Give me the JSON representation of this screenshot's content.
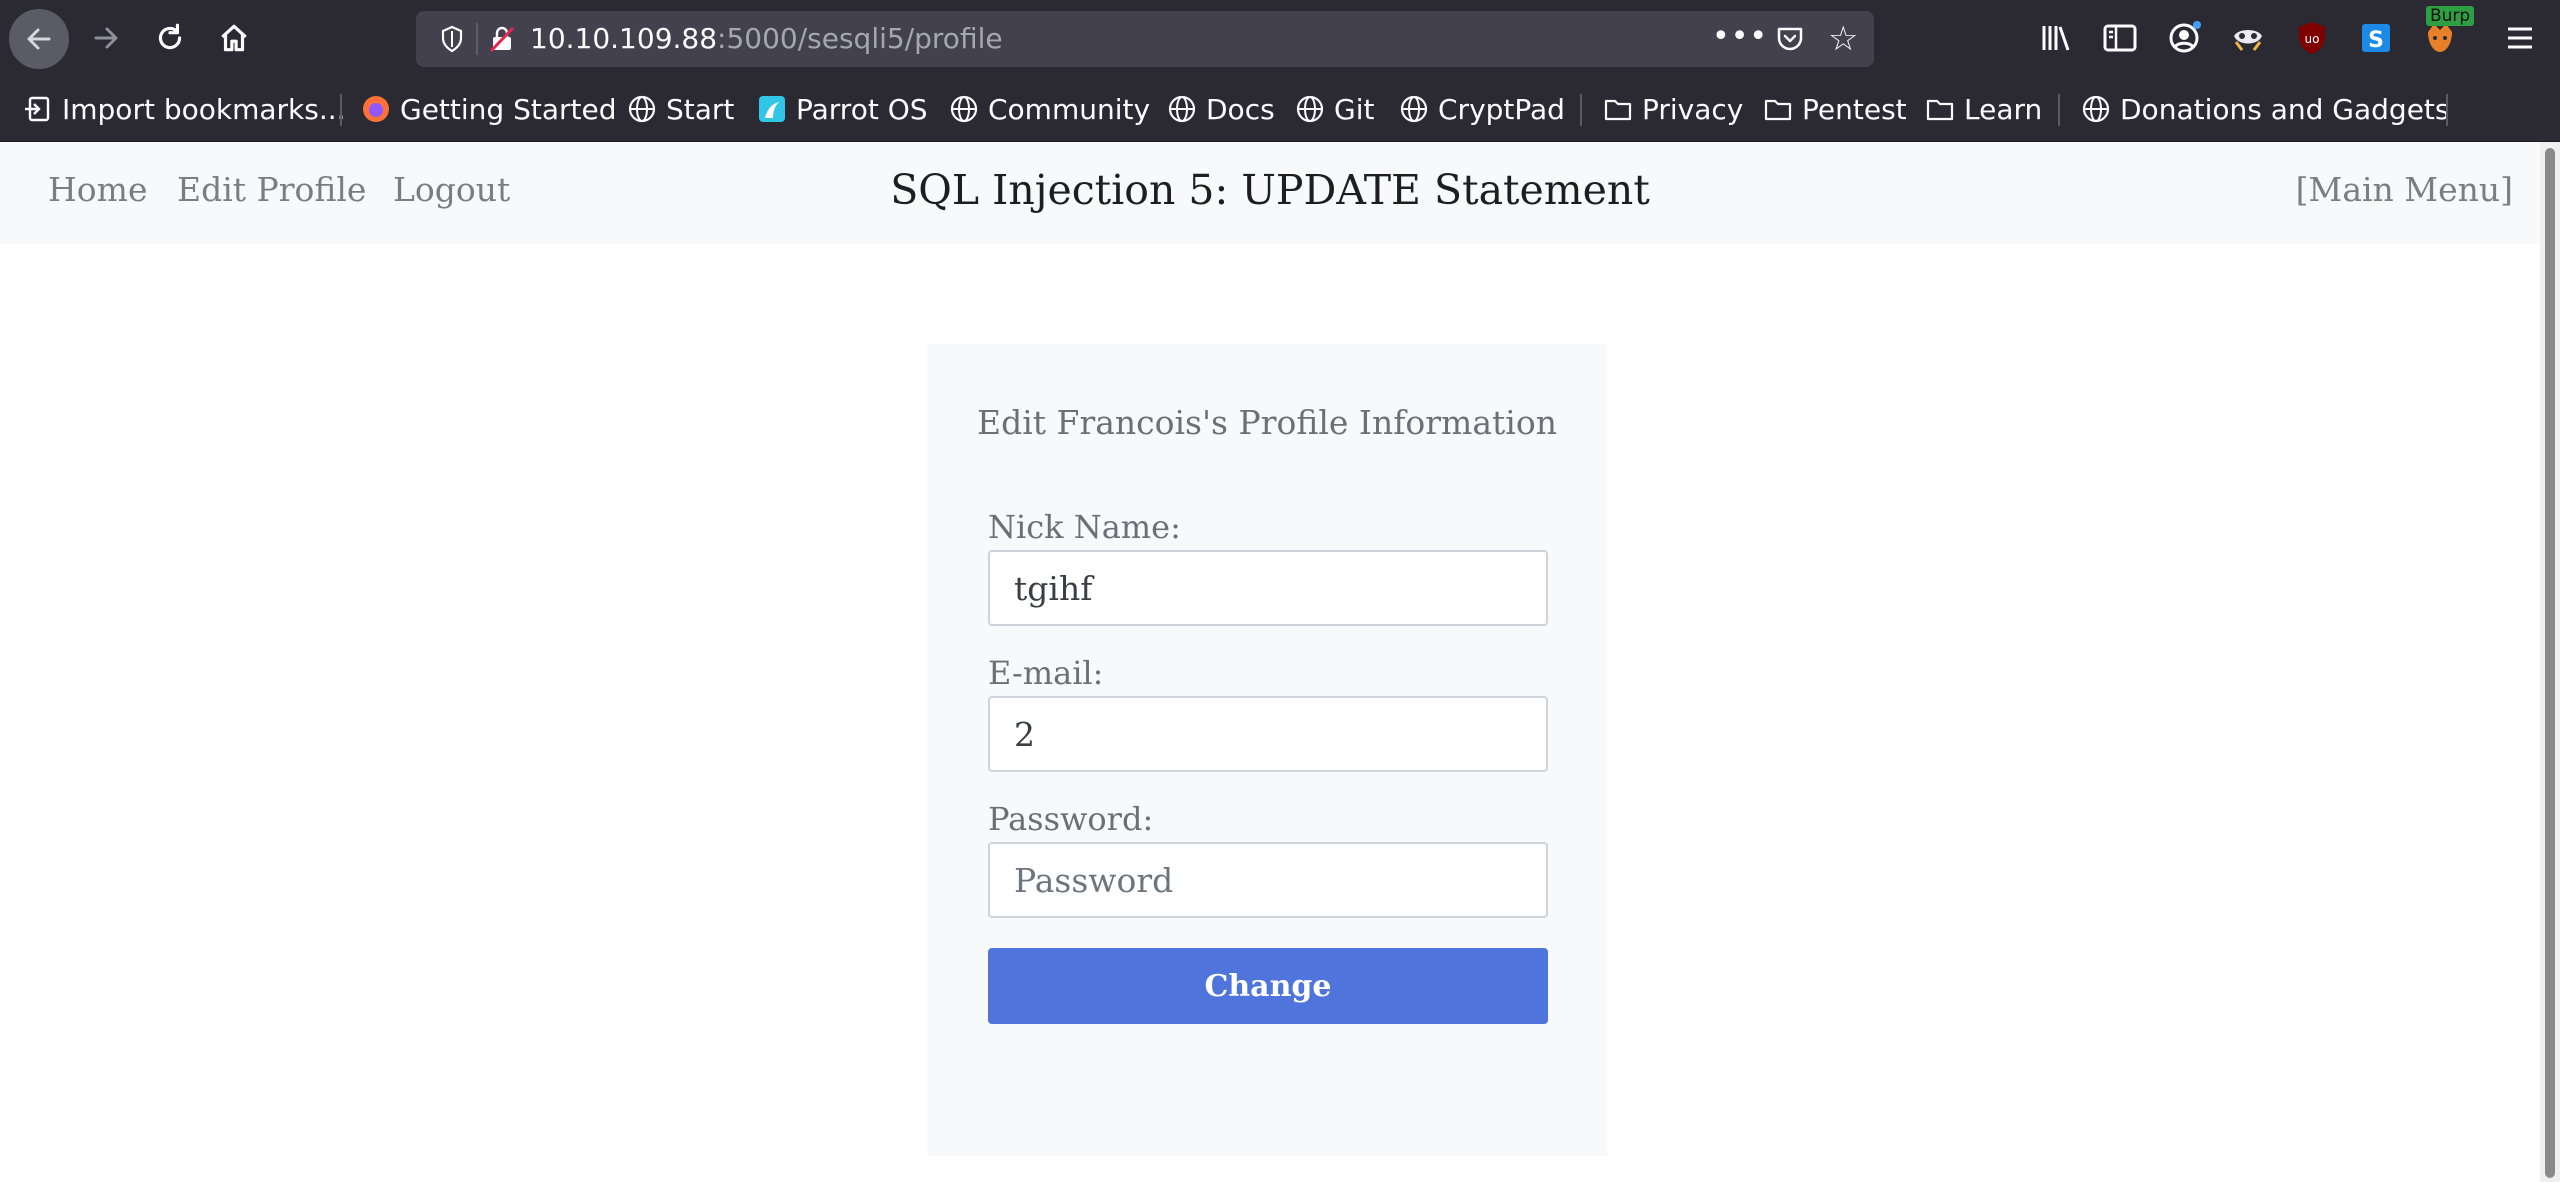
{
  "browser": {
    "url_host": "10.10.109.88",
    "url_path": ":5000/sesqli5/profile",
    "burp_badge": "Burp",
    "bookmarks": [
      {
        "label": "Import bookmarks...",
        "icon": "import-icon"
      },
      {
        "label": "Getting Started",
        "icon": "firefox-icon"
      },
      {
        "label": "Start",
        "icon": "globe-icon"
      },
      {
        "label": "Parrot OS",
        "icon": "parrot-icon"
      },
      {
        "label": "Community",
        "icon": "globe-icon"
      },
      {
        "label": "Docs",
        "icon": "globe-icon"
      },
      {
        "label": "Git",
        "icon": "globe-icon"
      },
      {
        "label": "CryptPad",
        "icon": "globe-icon"
      },
      {
        "label": "Privacy",
        "icon": "folder-icon"
      },
      {
        "label": "Pentest",
        "icon": "folder-icon"
      },
      {
        "label": "Learn",
        "icon": "folder-icon"
      },
      {
        "label": "Donations and Gadgets",
        "icon": "globe-icon"
      }
    ]
  },
  "nav": {
    "home": "Home",
    "edit_profile": "Edit Profile",
    "logout": "Logout",
    "title": "SQL Injection 5: UPDATE Statement",
    "main_menu": "[Main Menu]"
  },
  "form": {
    "title": "Edit Francois's Profile Information",
    "nickname_label": "Nick Name:",
    "nickname_value": "tgihf",
    "email_label": "E-mail:",
    "email_value": "2",
    "password_label": "Password:",
    "password_placeholder": "Password",
    "submit_label": "Change"
  },
  "colors": {
    "chrome": "#2b2a33",
    "urlbar": "#42414d",
    "button": "#4f75dd",
    "burp_badge": "#2ea043"
  }
}
